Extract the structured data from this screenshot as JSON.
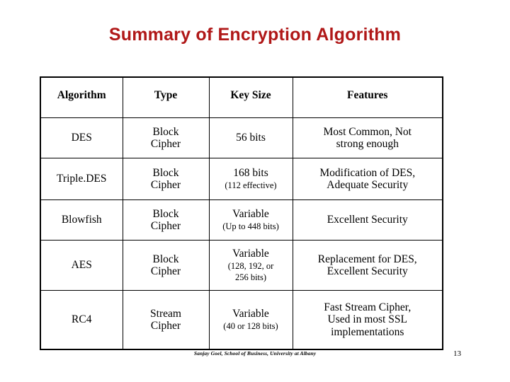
{
  "slide": {
    "title": "Summary of Encryption Algorithm",
    "title_color": "#b01818",
    "footer_credit": "Sanjay Goel, School of Business, University at Albany",
    "page_number": "13"
  },
  "table": {
    "headers": {
      "algorithm": "Algorithm",
      "type": "Type",
      "key_size": "Key Size",
      "features": "Features"
    },
    "rows": [
      {
        "algorithm": "DES",
        "type_line1": "Block",
        "type_line2": "Cipher",
        "key_size": "56 bits",
        "key_size_note": "",
        "key_size_note2": "",
        "features_line1": "Most Common, Not",
        "features_line2": "strong enough",
        "features_line3": ""
      },
      {
        "algorithm": "Triple.DES",
        "type_line1": "Block",
        "type_line2": "Cipher",
        "key_size": "168 bits",
        "key_size_note": "(112 effective)",
        "key_size_note2": "",
        "features_line1": "Modification of DES,",
        "features_line2": "Adequate Security",
        "features_line3": ""
      },
      {
        "algorithm": "Blowfish",
        "type_line1": "Block",
        "type_line2": "Cipher",
        "key_size": "Variable",
        "key_size_note": "(Up to 448 bits)",
        "key_size_note2": "",
        "features_line1": "Excellent Security",
        "features_line2": "",
        "features_line3": ""
      },
      {
        "algorithm": "AES",
        "type_line1": "Block",
        "type_line2": "Cipher",
        "key_size": "Variable",
        "key_size_note": "(128, 192, or",
        "key_size_note2": "256 bits)",
        "features_line1": "Replacement for DES,",
        "features_line2": "Excellent Security",
        "features_line3": ""
      },
      {
        "algorithm": "RC4",
        "type_line1": "Stream",
        "type_line2": "Cipher",
        "key_size": "Variable",
        "key_size_note": "(40 or 128 bits)",
        "key_size_note2": "",
        "features_line1": "Fast Stream Cipher,",
        "features_line2": "Used in most SSL",
        "features_line3": "implementations"
      }
    ]
  }
}
